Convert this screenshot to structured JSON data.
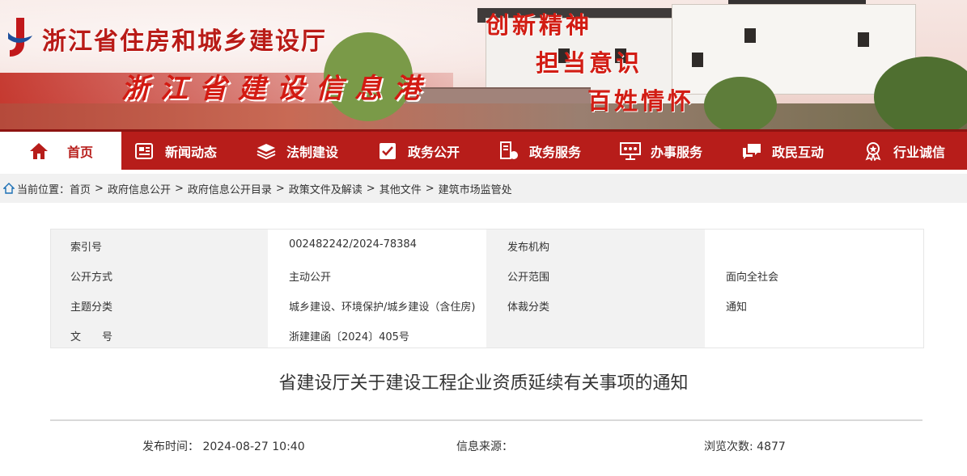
{
  "header": {
    "site_name": "浙江省住房和城乡建设厅",
    "sub_title": "浙江省建设信息港",
    "slogans": [
      "创新精神",
      "担当意识",
      "百姓情怀"
    ]
  },
  "nav": {
    "items": [
      {
        "label": "首页",
        "icon": "home-icon"
      },
      {
        "label": "新闻动态",
        "icon": "newspaper-icon"
      },
      {
        "label": "法制建设",
        "icon": "layers-icon"
      },
      {
        "label": "政务公开",
        "icon": "checklist-icon"
      },
      {
        "label": "政务服务",
        "icon": "service-icon"
      },
      {
        "label": "办事服务",
        "icon": "people-board-icon"
      },
      {
        "label": "政民互动",
        "icon": "chat-icon"
      },
      {
        "label": "行业诚信",
        "icon": "medal-icon"
      }
    ]
  },
  "breadcrumb": {
    "prefix": "当前位置：",
    "items": [
      "首页",
      "政府信息公开",
      "政府信息公开目录",
      "政策文件及解读",
      "其他文件",
      "建筑市场监管处"
    ],
    "separator": ">"
  },
  "info": {
    "rows": [
      {
        "label1": "索引号",
        "value1": "002482242/2024-78384",
        "label2": "发布机构",
        "value2": ""
      },
      {
        "label1": "公开方式",
        "value1": "主动公开",
        "label2": "公开范围",
        "value2": "面向全社会"
      },
      {
        "label1": "主题分类",
        "value1": "城乡建设、环境保护/城乡建设（含住房)",
        "label2": "体裁分类",
        "value2": "通知"
      },
      {
        "label1": "文　　号",
        "value1": "浙建建函〔2024〕405号",
        "label2": "",
        "value2": ""
      }
    ]
  },
  "article": {
    "title": "省建设厅关于建设工程企业资质延续有关事项的通知",
    "publish_label": "发布时间：",
    "publish_time": "2024-08-27 10:40",
    "source_label": "信息来源：",
    "views_label": "浏览次数: ",
    "views": "4877"
  },
  "colors": {
    "brand_red": "#b71d1a",
    "crumb_bg": "#f1f1f1",
    "table_shade": "#f2f2f2"
  }
}
